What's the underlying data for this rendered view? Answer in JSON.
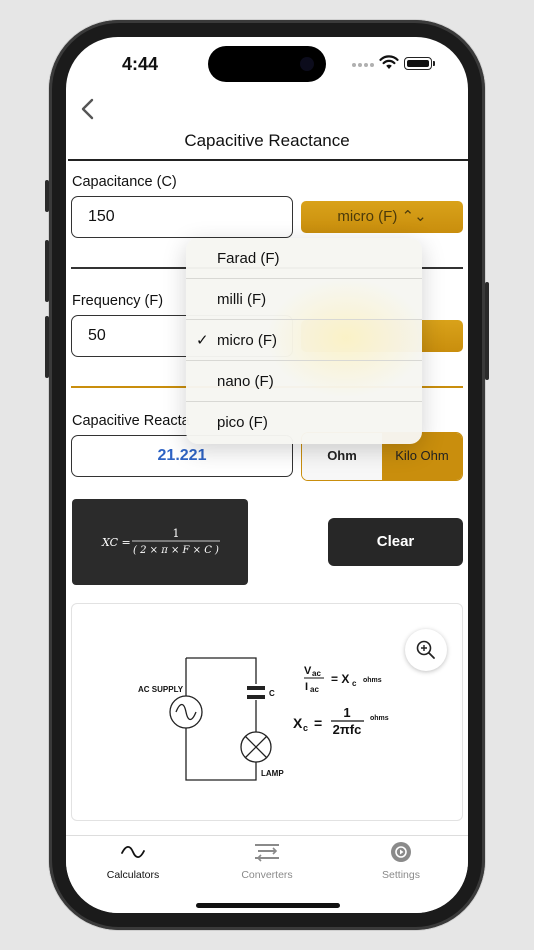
{
  "status": {
    "time": "4:44"
  },
  "header": {
    "title": "Capacitive Reactance"
  },
  "capacitance": {
    "label": "Capacitance (C)",
    "value": "150",
    "unit": "micro (F) ⌃⌄"
  },
  "frequency": {
    "label": "Frequency (F)",
    "value": "50"
  },
  "unit_menu": {
    "items": [
      {
        "label": "Farad (F)",
        "selected": false
      },
      {
        "label": "milli (F)",
        "selected": false
      },
      {
        "label": "micro (F)",
        "selected": true
      },
      {
        "label": "nano (F)",
        "selected": false
      },
      {
        "label": "pico (F)",
        "selected": false
      }
    ],
    "checkmark": "✓"
  },
  "result": {
    "label": "Capacitive Reacta",
    "value": "21.221",
    "unit_options": [
      "Ohm",
      "Kilo Ohm"
    ],
    "selected_unit": "Kilo Ohm"
  },
  "formula": {
    "lhs": "XC =",
    "numerator": "1",
    "denominator": "( 2 × π × F × C )"
  },
  "clear_label": "Clear",
  "diagram": {
    "supply_label": "AC SUPPLY",
    "cap_label": "C",
    "lamp_label": "LAMP",
    "eq1_num": "V",
    "eq1_num_sub": "ac",
    "eq1_den": "I",
    "eq1_den_sub": "ac",
    "eq1_rhs": "= X",
    "eq1_rhs_sub": "c",
    "eq1_unit": "ohms",
    "eq2_lhs": "X",
    "eq2_lhs_sub": "c",
    "eq2_eq": "=",
    "eq2_num": "1",
    "eq2_den": "2πfc",
    "eq2_unit": "ohms"
  },
  "tabs": [
    {
      "label": "Calculators",
      "active": true
    },
    {
      "label": "Converters",
      "active": false
    },
    {
      "label": "Settings",
      "active": false
    }
  ],
  "colors": {
    "accent": "#c98e0d",
    "result_text": "#2e63c4",
    "dark_button": "#272727"
  }
}
